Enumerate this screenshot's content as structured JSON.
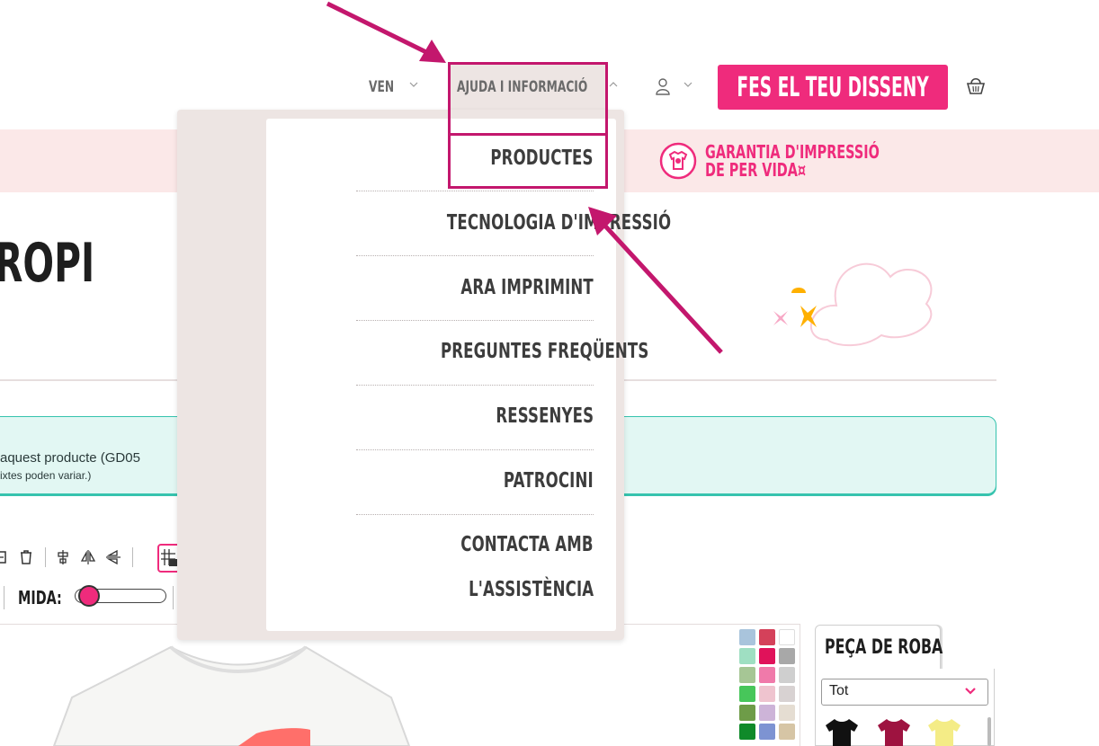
{
  "header": {
    "nav_sell": "VEN",
    "nav_help": "AJUDA I INFORMACIÓ",
    "cta_label": "FES EL TEU DISSENY",
    "icons": [
      "chevron-down-icon",
      "chevron-up-icon",
      "user-icon",
      "basket-icon"
    ]
  },
  "banner": {
    "guarantee_line1": "GARANTIA D'IMPRESSIÓ",
    "guarantee_line2": "DE PER VIDA¤",
    "icon": "tshirt-badge-icon"
  },
  "page": {
    "title": "ROPI"
  },
  "info": {
    "line1": " aquest producte (GD05",
    "line2": "ixtes poden variar.)"
  },
  "toolbar": {
    "size_label": "MIDA:",
    "slider_value": 0.1,
    "icons": [
      "duplicate-icon",
      "delete-icon",
      "center-align-icon",
      "flip-horizontal-icon",
      "flip-vertical-icon",
      "grid-icon"
    ]
  },
  "dropdown": {
    "items": [
      {
        "label": "PRODUCTES"
      },
      {
        "label": "TECNOLOGIA D'IMPRESSIÓ"
      },
      {
        "label": "ARA IMPRIMINT"
      },
      {
        "label": "PREGUNTES FREQÜENTS"
      },
      {
        "label": "RESSENYES"
      },
      {
        "label": "PATROCINI"
      },
      {
        "label": "CONTACTA AMB"
      },
      {
        "label": "L'ASSISTÈNCIA"
      }
    ]
  },
  "garment": {
    "tab_label": "PEÇA DE ROBA",
    "select_value": "Tot"
  },
  "swatch_colors": [
    "#a9c4dc",
    "#d4415a",
    "#ffffff",
    "#9fdfc2",
    "#e0125a",
    "#a8a8a8",
    "#a6c695",
    "#f07aaa",
    "#cfcfcf",
    "#47c65a",
    "#efc4cf",
    "#d8d2d2",
    "#6e9c48",
    "#cdb4d8",
    "#e5ddd2",
    "#0f8a29",
    "#7d93d2",
    "#d6c5a5"
  ],
  "colors": {
    "accent": "#ef2b7c",
    "annotation": "#c3176d",
    "banner_bg": "#fbe8e8",
    "info_bg": "#e2f7f3",
    "info_border": "#36c3ae"
  }
}
